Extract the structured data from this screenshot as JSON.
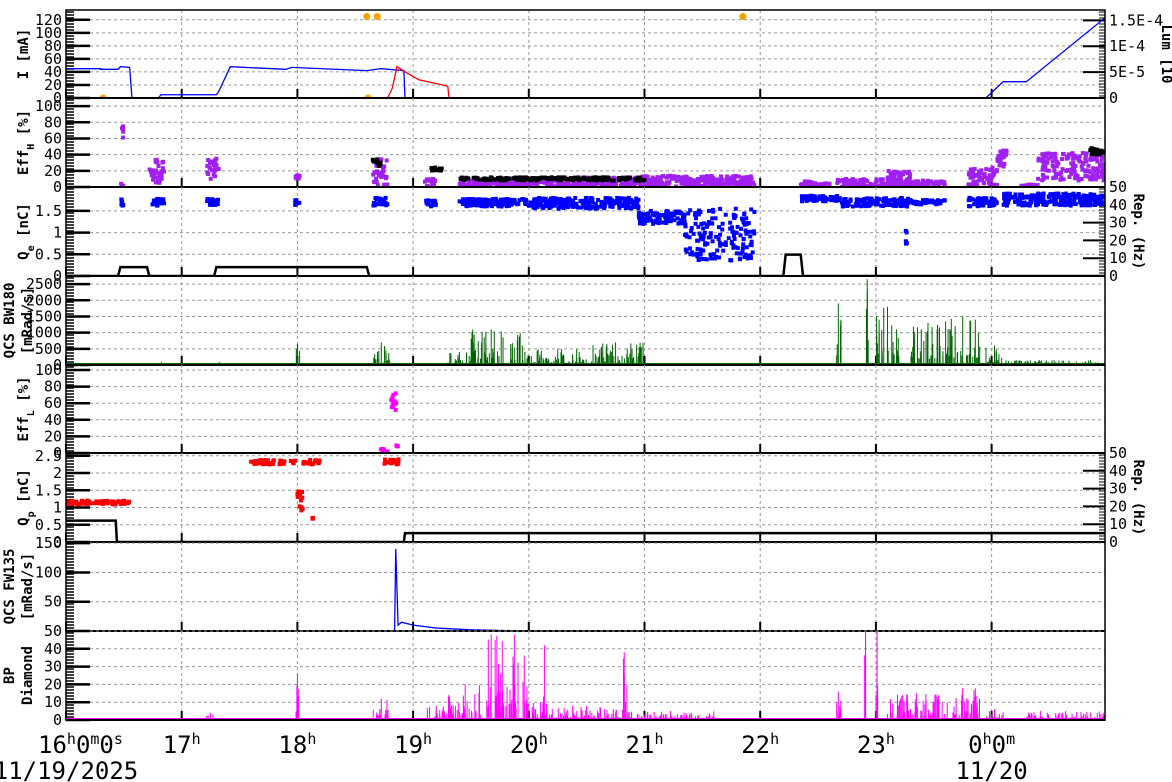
{
  "chart_data": {
    "type": "scatter",
    "title": "",
    "x_unit": "hour",
    "xlim": [
      16,
      24.98
    ],
    "x_ticks": [
      {
        "h": 16,
        "main": "16",
        "sup": "h",
        "m": "0",
        "supm": "m",
        "s": "0",
        "sups": "s"
      },
      {
        "h": 17,
        "main": "17",
        "sup": "h"
      },
      {
        "h": 18,
        "main": "18",
        "sup": "h"
      },
      {
        "h": 19,
        "main": "19",
        "sup": "h"
      },
      {
        "h": 20,
        "main": "20",
        "sup": "h"
      },
      {
        "h": 21,
        "main": "21",
        "sup": "h"
      },
      {
        "h": 22,
        "main": "22",
        "sup": "h"
      },
      {
        "h": 23,
        "main": "23",
        "sup": "h"
      },
      {
        "h": 24,
        "main": "0",
        "sup": "h",
        "m": "0",
        "supm": "m"
      }
    ],
    "dates": [
      {
        "h": 16,
        "label": "11/19/2025"
      },
      {
        "h": 24,
        "label": "11/20"
      }
    ],
    "grid": true,
    "panels": [
      {
        "id": "current",
        "ylabel": "I [mA]",
        "ylabel_main": "I [mA]",
        "ylim": [
          0,
          135
        ],
        "yticks": [
          0,
          20,
          40,
          60,
          80,
          100,
          120
        ],
        "right_label": "Lum [10",
        "right_ylim": [
          0,
          0.00017
        ],
        "right_ticks": [
          "0",
          "5E-5",
          "1E-4",
          "1.5E-4"
        ],
        "right_tick_values": [
          0,
          5e-05,
          0.0001,
          0.00015
        ],
        "lines": [
          {
            "name": "I_HER",
            "color": "#0000ff",
            "points": [
              [
                16,
                45
              ],
              [
                16.3,
                45
              ],
              [
                16.3,
                44
              ],
              [
                16.45,
                44
              ],
              [
                16.47,
                48
              ],
              [
                16.55,
                47
              ],
              [
                16.57,
                0
              ],
              [
                16.8,
                0
              ],
              [
                16.82,
                5
              ],
              [
                17.3,
                5
              ],
              [
                17.32,
                10
              ],
              [
                17.42,
                48
              ],
              [
                17.9,
                44
              ],
              [
                17.95,
                47
              ],
              [
                18.6,
                42
              ],
              [
                18.72,
                45
              ],
              [
                18.92,
                42
              ],
              [
                18.93,
                0
              ],
              [
                19.3,
                0
              ],
              [
                23.95,
                0
              ],
              [
                24.1,
                25
              ],
              [
                24.3,
                25
              ],
              [
                24.98,
                123
              ]
            ]
          },
          {
            "name": "I_LER",
            "color": "#ff0000",
            "points": [
              [
                16,
                0
              ],
              [
                18.78,
                0
              ],
              [
                18.82,
                15
              ],
              [
                18.86,
                48
              ],
              [
                18.95,
                38
              ],
              [
                19.05,
                28
              ],
              [
                19.2,
                22
              ],
              [
                19.3,
                18
              ],
              [
                19.31,
                0
              ],
              [
                24.98,
                0
              ]
            ]
          }
        ],
        "points": [
          {
            "name": "lum",
            "color": "#f5a300",
            "xy": [
              [
                16.32,
                0
              ],
              [
                18.61,
                0
              ],
              [
                18.6,
                125
              ],
              [
                18.69,
                125
              ],
              [
                21.85,
                125
              ]
            ]
          }
        ]
      },
      {
        "id": "effH",
        "ylabel_main": "Eff",
        "ylabel_sub": "H",
        "ylabel_tail": " [%]",
        "ylim": [
          0,
          110
        ],
        "yticks": [
          0,
          20,
          40,
          60,
          80,
          100
        ],
        "clusters": [
          {
            "color": "#a020f0",
            "c": [
              [
                16.48,
                16.5,
                55,
                75
              ],
              [
                16.47,
                16.5,
                0,
                5
              ],
              [
                16.72,
                16.85,
                5,
                35
              ],
              [
                17.22,
                17.32,
                10,
                35
              ],
              [
                17.98,
                18.02,
                8,
                16
              ],
              [
                18.65,
                18.78,
                2,
                35
              ],
              [
                19.1,
                19.2,
                0,
                10
              ],
              [
                19.4,
                20.0,
                0,
                10
              ],
              [
                20.0,
                20.95,
                0,
                12
              ],
              [
                20.95,
                21.95,
                0,
                14
              ],
              [
                22.35,
                22.45,
                0,
                8
              ],
              [
                22.4,
                22.6,
                0,
                5
              ],
              [
                22.65,
                23.2,
                0,
                10
              ],
              [
                23.1,
                23.3,
                0,
                20
              ],
              [
                23.25,
                23.6,
                0,
                8
              ],
              [
                23.8,
                24.05,
                0,
                25
              ],
              [
                24.05,
                24.15,
                25,
                45
              ],
              [
                24.25,
                24.4,
                0,
                3
              ],
              [
                24.4,
                24.98,
                8,
                42
              ]
            ]
          },
          {
            "color": "#000000",
            "c": [
              [
                18.65,
                18.72,
                25,
                35
              ],
              [
                19.15,
                19.25,
                20,
                25
              ],
              [
                19.4,
                20.0,
                8,
                12
              ],
              [
                20.0,
                21.0,
                8,
                12
              ],
              [
                24.84,
                24.98,
                40,
                48
              ]
            ]
          }
        ]
      },
      {
        "id": "qe",
        "ylabel_main": "Q",
        "ylabel_sub": "e",
        "ylabel_tail": " [nC]",
        "ylim": [
          0,
          2.05
        ],
        "yticks": [
          0,
          0.5,
          1,
          1.5
        ],
        "ytick_labels": [
          "0",
          "0.5",
          "1",
          "1.5"
        ],
        "right_label": "Rep. (Hz)",
        "right_ylim": [
          0,
          50
        ],
        "right_ticks": [
          "0",
          "10",
          "20",
          "30",
          "40",
          "50"
        ],
        "right_tick_values": [
          0,
          10,
          20,
          30,
          40,
          50
        ],
        "clusters": [
          {
            "color": "#0000ff",
            "c": [
              [
                16.47,
                16.5,
                1.62,
                1.8
              ],
              [
                16.72,
                16.85,
                1.62,
                1.78
              ],
              [
                17.22,
                17.32,
                1.62,
                1.78
              ],
              [
                17.98,
                18.02,
                1.62,
                1.76
              ],
              [
                18.65,
                18.78,
                1.62,
                1.8
              ],
              [
                19.1,
                19.2,
                1.6,
                1.75
              ],
              [
                19.4,
                20.0,
                1.6,
                1.78
              ],
              [
                20.0,
                20.95,
                1.55,
                1.8
              ],
              [
                20.95,
                21.35,
                1.2,
                1.5
              ],
              [
                21.35,
                21.95,
                0.35,
                1.55
              ],
              [
                22.35,
                22.7,
                1.72,
                1.85
              ],
              [
                22.7,
                23.3,
                1.6,
                1.8
              ],
              [
                23.25,
                23.6,
                1.65,
                1.75
              ],
              [
                23.8,
                24.05,
                1.6,
                1.8
              ],
              [
                24.1,
                24.98,
                1.62,
                1.9
              ],
              [
                23.25,
                23.27,
                0.7,
                1.05
              ]
            ]
          }
        ],
        "rep_line": {
          "color": "#000000",
          "points": [
            [
              16,
              0
            ],
            [
              16.45,
              0
            ],
            [
              16.47,
              5
            ],
            [
              16.7,
              5
            ],
            [
              16.72,
              0
            ],
            [
              17.28,
              0
            ],
            [
              17.3,
              5
            ],
            [
              18.6,
              5
            ],
            [
              18.62,
              0
            ],
            [
              22.2,
              0
            ],
            [
              22.22,
              12
            ],
            [
              22.35,
              12
            ],
            [
              22.37,
              0
            ],
            [
              24.98,
              0
            ]
          ]
        }
      },
      {
        "id": "bw180",
        "ylabel_main": "QCS BW180",
        "ylabel_line2": "[mRad/s]",
        "ylim": [
          0,
          2750
        ],
        "yticks": [
          0,
          500,
          1000,
          1500,
          2000,
          2500
        ],
        "spikes": {
          "color": "#006400",
          "c": [
            [
              16.8,
              16.85,
              100
            ],
            [
              17.3,
              17.35,
              100
            ],
            [
              17.98,
              18.02,
              650
            ],
            [
              18.65,
              18.8,
              700
            ],
            [
              19.3,
              19.5,
              400
            ],
            [
              19.5,
              19.85,
              1100
            ],
            [
              19.85,
              20.0,
              1000
            ],
            [
              20.0,
              20.5,
              500
            ],
            [
              20.5,
              21.0,
              700
            ],
            [
              22.65,
              22.7,
              1900
            ],
            [
              22.9,
              22.95,
              2650
            ],
            [
              23.0,
              23.2,
              1800
            ],
            [
              23.3,
              23.6,
              1300
            ],
            [
              23.6,
              23.9,
              1500
            ],
            [
              23.95,
              24.1,
              600
            ],
            [
              24.1,
              24.98,
              150
            ]
          ]
        }
      },
      {
        "id": "effL",
        "ylabel_main": "Eff",
        "ylabel_sub": "L",
        "ylabel_tail": " [%]",
        "ylim": [
          0,
          106
        ],
        "yticks": [
          0,
          20,
          40,
          60,
          80,
          100
        ],
        "clusters": [
          {
            "color": "#ff00ff",
            "c": [
              [
                18.8,
                18.86,
                50,
                72
              ],
              [
                18.72,
                18.78,
                0,
                5
              ],
              [
                18.84,
                18.87,
                8,
                12
              ]
            ]
          }
        ]
      },
      {
        "id": "qp",
        "ylabel_main": "Q",
        "ylabel_sub": "p",
        "ylabel_tail": " [nC]",
        "ylim": [
          0,
          2.58
        ],
        "yticks": [
          0,
          0.5,
          1,
          1.5,
          2,
          2.5
        ],
        "ytick_labels": [
          "0",
          "0.5",
          "1",
          "1.5",
          "2",
          "2.5"
        ],
        "right_label": "Rep. (Hz)",
        "right_ylim": [
          0,
          50
        ],
        "right_ticks": [
          "0",
          "10",
          "20",
          "30",
          "40",
          "50"
        ],
        "right_tick_values": [
          0,
          10,
          20,
          30,
          40,
          50
        ],
        "clusters": [
          {
            "color": "#ff0000",
            "c": [
              [
                16.0,
                16.55,
                1.08,
                1.2
              ],
              [
                17.6,
                18.0,
                2.25,
                2.38
              ],
              [
                18.05,
                18.2,
                2.25,
                2.4
              ],
              [
                18.75,
                18.88,
                2.25,
                2.4
              ],
              [
                18.0,
                18.05,
                0.9,
                1.5
              ],
              [
                18.12,
                18.14,
                0.65,
                0.7
              ]
            ]
          }
        ],
        "rep_line": {
          "color": "#000000",
          "points": [
            [
              16,
              12
            ],
            [
              16.43,
              12
            ],
            [
              16.44,
              0
            ],
            [
              18.92,
              0
            ],
            [
              18.93,
              5
            ],
            [
              24.98,
              5
            ]
          ]
        }
      },
      {
        "id": "fw135",
        "ylabel_main": "QCS FW135",
        "ylabel_line2": "[mRad/s]",
        "ylim": [
          0,
          152
        ],
        "yticks": [
          50,
          100,
          150
        ],
        "lines": [
          {
            "name": "FW135",
            "color": "#0000ff",
            "points": [
              [
                16,
                0
              ],
              [
                18.84,
                0
              ],
              [
                18.85,
                140
              ],
              [
                18.87,
                10
              ],
              [
                18.9,
                15
              ],
              [
                19.0,
                10
              ],
              [
                19.2,
                5
              ],
              [
                19.5,
                2
              ],
              [
                20,
                0
              ],
              [
                24.98,
                0
              ]
            ]
          }
        ]
      },
      {
        "id": "bp_diamond",
        "ylabel_main": "BP",
        "ylabel_line2": "Diamond",
        "ylim": [
          0,
          50
        ],
        "yticks": [
          0,
          10,
          20,
          30,
          40,
          50
        ],
        "spikes": {
          "color": "#ff00ff",
          "c": [
            [
              16.0,
              16.5,
              1
            ],
            [
              17.2,
              17.3,
              4
            ],
            [
              17.98,
              18.02,
              26
            ],
            [
              18.65,
              18.8,
              12
            ],
            [
              19.1,
              19.3,
              8
            ],
            [
              19.3,
              19.6,
              20
            ],
            [
              19.6,
              19.75,
              48
            ],
            [
              19.75,
              20.0,
              48
            ],
            [
              20.0,
              20.2,
              10
            ],
            [
              20.12,
              20.15,
              42
            ],
            [
              20.2,
              20.8,
              8
            ],
            [
              20.8,
              20.85,
              38
            ],
            [
              20.85,
              21.6,
              5
            ],
            [
              22.65,
              22.7,
              16
            ],
            [
              22.9,
              22.92,
              50
            ],
            [
              23.0,
              23.02,
              50
            ],
            [
              23.1,
              23.6,
              15
            ],
            [
              23.6,
              23.9,
              18
            ],
            [
              23.95,
              24.1,
              6
            ],
            [
              24.3,
              24.98,
              5
            ]
          ]
        }
      }
    ]
  }
}
